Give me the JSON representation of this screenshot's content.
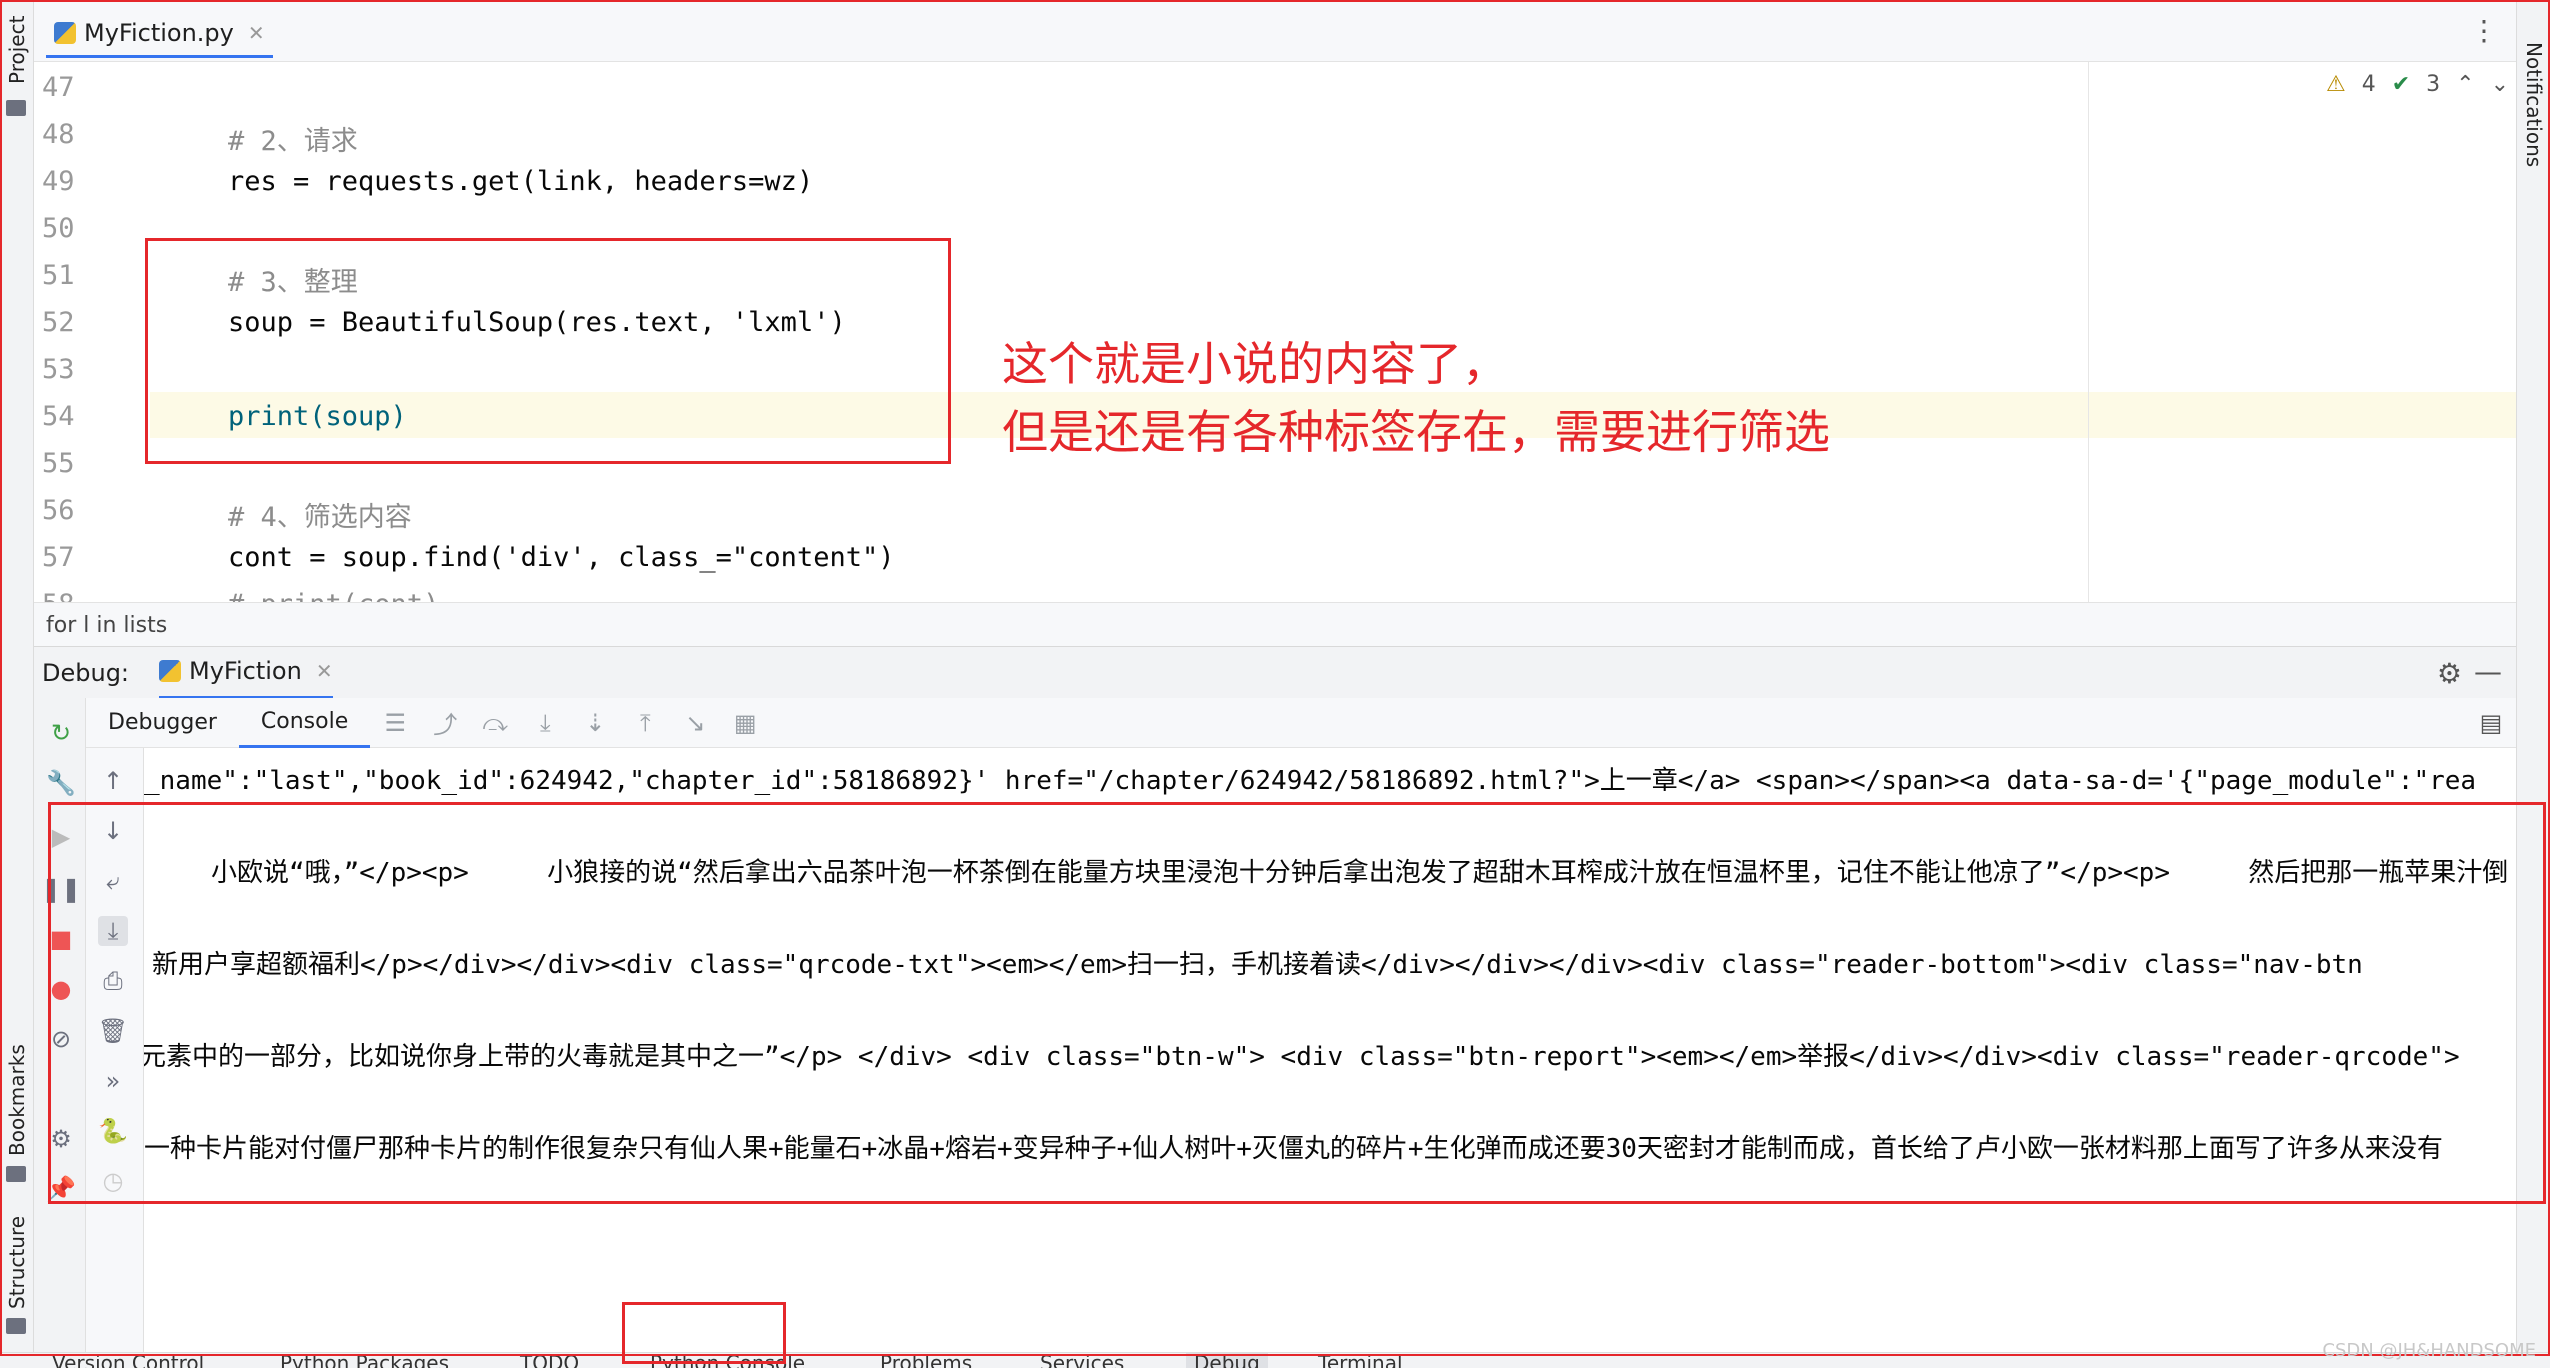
{
  "editor": {
    "file_tab": "MyFiction.py",
    "inspection": {
      "warnings": "4",
      "weak_warnings": "3"
    },
    "lines": [
      {
        "no": "47",
        "text": ""
      },
      {
        "no": "48",
        "text": "# 2、请求"
      },
      {
        "no": "49",
        "text": "res = requests.get(link, headers=wz)"
      },
      {
        "no": "50",
        "text": ""
      },
      {
        "no": "51",
        "text": "# 3、整理"
      },
      {
        "no": "52",
        "text": "soup = BeautifulSoup(res.text, 'lxml')"
      },
      {
        "no": "53",
        "text": ""
      },
      {
        "no": "54",
        "text": "print(soup)"
      },
      {
        "no": "55",
        "text": ""
      },
      {
        "no": "56",
        "text": "# 4、筛选内容"
      },
      {
        "no": "57",
        "text": "cont = soup.find('div', class_=\"content\")"
      },
      {
        "no": "58",
        "text": "# print(cont)"
      }
    ],
    "breadcrumb": "for l in lists"
  },
  "left_strip": {
    "project": "Project",
    "bookmarks": "Bookmarks",
    "structure": "Structure"
  },
  "right_strip": {
    "notifications": "Notifications"
  },
  "debug": {
    "label": "Debug:",
    "run_name": "MyFiction",
    "tabs": [
      "Debugger",
      "Console"
    ],
    "console_lines": [
      "_name\":\"last\",\"book_id\":624942,\"chapter_id\":58186892}' href=\"/chapter/624942/58186892.html?\">上一章</a> <span></span><a data-sa-d='{\"page_module\":\"rea",
      "   小欧说“哦，”</p><p>     小狼接的说“然后拿出六品茶叶泡一杯茶倒在能量方块里浸泡十分钟后拿出泡发了超甜木耳榨成汁放在恒温杯里，记住不能让他凉了”</p><p>     然后把那一瓶苹果汁倒",
      "新用户享超额福利</p></div></div><div class=\"qrcode-txt\"><em></em>扫一扫，手机接着读</div></div></div><div class=\"reader-bottom\"><div class=\"nav-btn",
      "元素中的一部分，比如说你身上带的火毒就是其中之一”</p> </div> <div class=\"btn-w\"> <div class=\"btn-report\"><em></em>举报</div></div><div class=\"reader-qrcode\">",
      "一种卡片能对付僵尸那种卡片的制作很复杂只有仙人果+能量石+冰晶+熔岩+变异种子+仙人树叶+灭僵丸的碎片+生化弹而成还要30天密封才能制而成，首长给了卢小欧一张材料那上面写了许多从来没有"
    ]
  },
  "annotation": {
    "line1": "这个就是小说的内容了，",
    "line2": "但是还是有各种标签存在，需要进行筛选"
  },
  "status_bar": [
    "Version Control",
    "Python Packages",
    "TODO",
    "Python Console",
    "Problems",
    "Services",
    "Debug",
    "Terminal"
  ],
  "watermark": "CSDN @JH&HANDSOME",
  "colors": {
    "accent": "#3574f0",
    "annotation_red": "#e5272b",
    "comment": "#8c8c8c",
    "string": "#067d17",
    "keyword": "#871094"
  }
}
